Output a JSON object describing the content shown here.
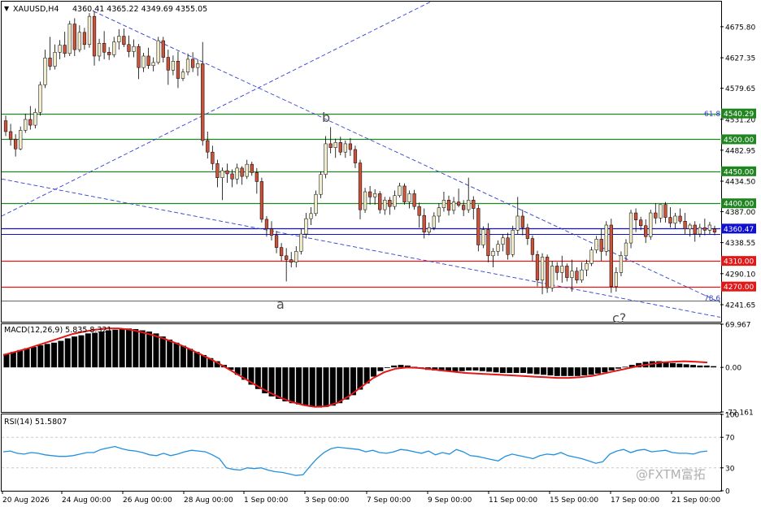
{
  "symbol": "XAUUSD,H4",
  "ohlc": "4360.41 4365.22 4349.69 4355.05",
  "macd_header": "MACD(12,26,9) 5.835 8.321",
  "rsi_header": "RSI(14) 51.5807",
  "watermark": "@FXTM富拓",
  "fib_labels": {
    "fib_618": "61.8",
    "fib_786": "78.6"
  },
  "wave_labels": {
    "a": "a",
    "b": "b",
    "c": "c?"
  },
  "colors": {
    "bull": "#f0eccc",
    "bear": "#c8533a",
    "support": "#208520",
    "resistance": "#e01818",
    "current": "#1010d0",
    "trendline": "#3040d0",
    "signal": "#e01818",
    "rsi": "#2090e0"
  },
  "price_axis": [
    "4675.80",
    "4627.35",
    "4579.65",
    "4531.20",
    "4482.95",
    "4434.50",
    "4387.00",
    "4338.55",
    "4290.10",
    "4241.65"
  ],
  "level_tags": [
    {
      "label": "4540.29",
      "color": "#208520"
    },
    {
      "label": "4500.00",
      "color": "#208520"
    },
    {
      "label": "4450.00",
      "color": "#208520"
    },
    {
      "label": "4400.00",
      "color": "#208520"
    },
    {
      "label": "4360.47",
      "color": "#1010d0"
    },
    {
      "label": "4310.00",
      "color": "#e01818"
    },
    {
      "label": "4270.00",
      "color": "#e01818"
    }
  ],
  "macd_axis": [
    "69.967",
    "0.00",
    "-72.161"
  ],
  "rsi_axis": [
    "100",
    "70",
    "30",
    "0"
  ],
  "time_axis": [
    "20 Aug 2026",
    "24 Aug 00:00",
    "26 Aug 00:00",
    "28 Aug 00:00",
    "1 Sep 00:00",
    "3 Sep 00:00",
    "7 Sep 00:00",
    "9 Sep 00:00",
    "11 Sep 00:00",
    "15 Sep 00:00",
    "17 Sep 00:00",
    "21 Sep 00:00"
  ],
  "chart_data": {
    "type": "candlestick",
    "ohlc": [
      [
        4529,
        4537,
        4505,
        4512
      ],
      [
        4512,
        4524,
        4490,
        4500
      ],
      [
        4500,
        4508,
        4473,
        4485
      ],
      [
        4485,
        4520,
        4483,
        4514
      ],
      [
        4514,
        4540,
        4510,
        4531
      ],
      [
        4531,
        4552,
        4515,
        4522
      ],
      [
        4522,
        4548,
        4517,
        4542
      ],
      [
        4542,
        4590,
        4537,
        4585
      ],
      [
        4585,
        4640,
        4580,
        4627
      ],
      [
        4627,
        4660,
        4608,
        4614
      ],
      [
        4614,
        4648,
        4609,
        4636
      ],
      [
        4636,
        4655,
        4625,
        4647
      ],
      [
        4647,
        4668,
        4628,
        4634
      ],
      [
        4634,
        4685,
        4630,
        4680
      ],
      [
        4680,
        4689,
        4630,
        4640
      ],
      [
        4640,
        4678,
        4636,
        4667
      ],
      [
        4667,
        4674,
        4640,
        4648
      ],
      [
        4648,
        4697,
        4643,
        4692
      ],
      [
        4692,
        4700,
        4615,
        4630
      ],
      [
        4630,
        4657,
        4622,
        4650
      ],
      [
        4650,
        4669,
        4625,
        4636
      ],
      [
        4636,
        4644,
        4624,
        4632
      ],
      [
        4632,
        4660,
        4628,
        4652
      ],
      [
        4652,
        4672,
        4640,
        4661
      ],
      [
        4661,
        4673,
        4644,
        4648
      ],
      [
        4648,
        4662,
        4628,
        4637
      ],
      [
        4637,
        4656,
        4628,
        4645
      ],
      [
        4645,
        4649,
        4594,
        4612
      ],
      [
        4612,
        4635,
        4605,
        4630
      ],
      [
        4630,
        4643,
        4610,
        4615
      ],
      [
        4615,
        4628,
        4606,
        4620
      ],
      [
        4620,
        4660,
        4617,
        4654
      ],
      [
        4654,
        4660,
        4620,
        4628
      ],
      [
        4628,
        4640,
        4585,
        4608
      ],
      [
        4608,
        4631,
        4600,
        4622
      ],
      [
        4622,
        4637,
        4580,
        4595
      ],
      [
        4595,
        4610,
        4591,
        4605
      ],
      [
        4605,
        4634,
        4600,
        4625
      ],
      [
        4625,
        4636,
        4605,
        4612
      ],
      [
        4612,
        4625,
        4599,
        4618
      ],
      [
        4618,
        4652,
        4490,
        4498
      ],
      [
        4498,
        4512,
        4470,
        4480
      ],
      [
        4480,
        4490,
        4452,
        4462
      ],
      [
        4462,
        4468,
        4425,
        4440
      ],
      [
        4440,
        4456,
        4405,
        4451
      ],
      [
        4451,
        4462,
        4432,
        4446
      ],
      [
        4446,
        4453,
        4425,
        4438
      ],
      [
        4438,
        4462,
        4430,
        4455
      ],
      [
        4455,
        4458,
        4429,
        4442
      ],
      [
        4442,
        4468,
        4438,
        4461
      ],
      [
        4461,
        4465,
        4443,
        4448
      ],
      [
        4448,
        4455,
        4415,
        4434
      ],
      [
        4434,
        4440,
        4370,
        4375
      ],
      [
        4375,
        4380,
        4348,
        4360
      ],
      [
        4360,
        4372,
        4342,
        4350
      ],
      [
        4350,
        4357,
        4322,
        4331
      ],
      [
        4331,
        4338,
        4310,
        4318
      ],
      [
        4318,
        4330,
        4278,
        4312
      ],
      [
        4312,
        4324,
        4300,
        4308
      ],
      [
        4308,
        4333,
        4300,
        4325
      ],
      [
        4325,
        4360,
        4320,
        4352
      ],
      [
        4352,
        4385,
        4345,
        4376
      ],
      [
        4376,
        4394,
        4366,
        4384
      ],
      [
        4384,
        4420,
        4380,
        4414
      ],
      [
        4414,
        4450,
        4408,
        4445
      ],
      [
        4445,
        4505,
        4439,
        4493
      ],
      [
        4493,
        4519,
        4478,
        4487
      ],
      [
        4487,
        4501,
        4471,
        4495
      ],
      [
        4495,
        4504,
        4475,
        4480
      ],
      [
        4480,
        4498,
        4471,
        4493
      ],
      [
        4493,
        4502,
        4474,
        4484
      ],
      [
        4484,
        4490,
        4455,
        4463
      ],
      [
        4463,
        4468,
        4375,
        4390
      ],
      [
        4390,
        4424,
        4385,
        4418
      ],
      [
        4418,
        4427,
        4398,
        4410
      ],
      [
        4410,
        4422,
        4398,
        4415
      ],
      [
        4415,
        4419,
        4384,
        4390
      ],
      [
        4390,
        4410,
        4382,
        4405
      ],
      [
        4405,
        4410,
        4382,
        4395
      ],
      [
        4395,
        4420,
        4390,
        4412
      ],
      [
        4412,
        4432,
        4409,
        4427
      ],
      [
        4427,
        4431,
        4398,
        4402
      ],
      [
        4402,
        4420,
        4392,
        4415
      ],
      [
        4415,
        4421,
        4390,
        4395
      ],
      [
        4395,
        4401,
        4362,
        4381
      ],
      [
        4381,
        4392,
        4345,
        4355
      ],
      [
        4355,
        4370,
        4350,
        4362
      ],
      [
        4362,
        4386,
        4358,
        4380
      ],
      [
        4380,
        4400,
        4370,
        4393
      ],
      [
        4393,
        4418,
        4387,
        4405
      ],
      [
        4405,
        4412,
        4381,
        4389
      ],
      [
        4389,
        4410,
        4383,
        4402
      ],
      [
        4402,
        4423,
        4394,
        4397
      ],
      [
        4397,
        4405,
        4380,
        4390
      ],
      [
        4390,
        4440,
        4385,
        4405
      ],
      [
        4405,
        4411,
        4375,
        4392
      ],
      [
        4392,
        4398,
        4325,
        4335
      ],
      [
        4335,
        4364,
        4330,
        4359
      ],
      [
        4359,
        4369,
        4308,
        4318
      ],
      [
        4318,
        4330,
        4300,
        4325
      ],
      [
        4325,
        4342,
        4318,
        4336
      ],
      [
        4336,
        4352,
        4325,
        4346
      ],
      [
        4346,
        4354,
        4312,
        4320
      ],
      [
        4320,
        4365,
        4316,
        4358
      ],
      [
        4358,
        4410,
        4352,
        4380
      ],
      [
        4380,
        4390,
        4350,
        4362
      ],
      [
        4362,
        4368,
        4335,
        4345
      ],
      [
        4345,
        4350,
        4310,
        4320
      ],
      [
        4320,
        4326,
        4270,
        4280
      ],
      [
        4280,
        4322,
        4258,
        4316
      ],
      [
        4316,
        4320,
        4260,
        4268
      ],
      [
        4268,
        4310,
        4262,
        4302
      ],
      [
        4302,
        4308,
        4280,
        4292
      ],
      [
        4292,
        4318,
        4276,
        4302
      ],
      [
        4302,
        4306,
        4278,
        4284
      ],
      [
        4284,
        4312,
        4262,
        4294
      ],
      [
        4294,
        4300,
        4275,
        4280
      ],
      [
        4280,
        4308,
        4276,
        4296
      ],
      [
        4296,
        4312,
        4286,
        4306
      ],
      [
        4306,
        4332,
        4302,
        4327
      ],
      [
        4327,
        4349,
        4322,
        4344
      ],
      [
        4344,
        4360,
        4310,
        4325
      ],
      [
        4325,
        4372,
        4318,
        4366
      ],
      [
        4366,
        4376,
        4260,
        4270
      ],
      [
        4270,
        4300,
        4262,
        4292
      ],
      [
        4292,
        4325,
        4286,
        4318
      ],
      [
        4318,
        4344,
        4310,
        4338
      ],
      [
        4338,
        4390,
        4330,
        4385
      ],
      [
        4385,
        4392,
        4355,
        4374
      ],
      [
        4374,
        4379,
        4358,
        4365
      ],
      [
        4365,
        4375,
        4338,
        4348
      ],
      [
        4348,
        4390,
        4343,
        4385
      ],
      [
        4385,
        4400,
        4368,
        4377
      ],
      [
        4377,
        4398,
        4370,
        4398
      ],
      [
        4398,
        4402,
        4370,
        4378
      ],
      [
        4378,
        4394,
        4362,
        4369
      ],
      [
        4369,
        4385,
        4360,
        4380
      ],
      [
        4380,
        4392,
        4368,
        4372
      ],
      [
        4372,
        4385,
        4352,
        4360
      ],
      [
        4360,
        4369,
        4348,
        4366
      ],
      [
        4366,
        4372,
        4340,
        4352
      ],
      [
        4352,
        4368,
        4347,
        4362
      ],
      [
        4362,
        4376,
        4350,
        4358
      ],
      [
        4358,
        4371,
        4352,
        4366
      ],
      [
        4360,
        4365,
        4350,
        4355
      ]
    ],
    "histogram": [
      22,
      25,
      28,
      31,
      33,
      36,
      38,
      40,
      43,
      47,
      50,
      52,
      55,
      56,
      58,
      60,
      61,
      62,
      63,
      62,
      60,
      58,
      55,
      50,
      45,
      40,
      35,
      30,
      25,
      20,
      15,
      10,
      4,
      -4,
      -12,
      -20,
      -28,
      -35,
      -42,
      -47,
      -51,
      -55,
      -58,
      -60,
      -62,
      -64,
      -65,
      -64,
      -62,
      -58,
      -52,
      -45,
      -36,
      -26,
      -15,
      -6,
      0,
      3,
      4,
      3,
      1,
      -2,
      -4,
      -5,
      -6,
      -7,
      -7,
      -6,
      -5,
      -5,
      -6,
      -7,
      -8,
      -9,
      -9,
      -9,
      -9,
      -10,
      -11,
      -12,
      -13,
      -14,
      -14,
      -14,
      -14,
      -13,
      -12,
      -10,
      -8,
      -5,
      -2,
      1,
      4,
      7,
      9,
      10,
      10,
      9,
      7,
      6,
      5,
      4,
      3,
      3,
      2
    ],
    "signal": [
      20,
      25,
      30,
      36,
      42,
      48,
      54,
      58,
      61,
      63,
      63,
      61,
      57,
      52,
      46,
      39,
      31,
      22,
      13,
      3,
      -8,
      -19,
      -30,
      -40,
      -49,
      -56,
      -61,
      -64,
      -63,
      -57,
      -46,
      -32,
      -18,
      -8,
      -2,
      0,
      -1,
      -3,
      -5,
      -7,
      -9,
      -10,
      -11,
      -12,
      -13,
      -14,
      -15,
      -16,
      -17,
      -17,
      -16,
      -14,
      -10,
      -6,
      -2,
      2,
      5,
      8,
      9,
      10,
      9,
      8
    ],
    "rsi": [
      51,
      52,
      49,
      48,
      50,
      49,
      47,
      46,
      45,
      45,
      46,
      48,
      50,
      50,
      54,
      56,
      58,
      55,
      53,
      52,
      50,
      47,
      46,
      49,
      46,
      48,
      51,
      53,
      52,
      51,
      47,
      42,
      30,
      28,
      27,
      30,
      29,
      30,
      27,
      25,
      24,
      22,
      20,
      21,
      32,
      42,
      50,
      55,
      57,
      56,
      55,
      54,
      51,
      53,
      50,
      49,
      51,
      54,
      53,
      51,
      49,
      52,
      47,
      50,
      48,
      54,
      51,
      46,
      45,
      43,
      41,
      39,
      45,
      48,
      46,
      44,
      42,
      46,
      48,
      47,
      50,
      46,
      44,
      42,
      39,
      36,
      38,
      48,
      52,
      54,
      50,
      53,
      54,
      51,
      52,
      53,
      50,
      49,
      49,
      48,
      51,
      52
    ],
    "levels": {
      "fib_618": 4540.29,
      "r1": 4500.0,
      "r2": 4450.0,
      "r3": 4400.0,
      "current": 4360.47,
      "s1": 4310.0,
      "s2": 4270.0,
      "fib_786": 4248.0
    },
    "price_range": [
      4215,
      4715
    ],
    "macd_range": [
      -72.161,
      69.967
    ],
    "rsi_range": [
      0,
      100
    ],
    "ytick_values": [
      4675.8,
      4627.35,
      4579.65,
      4531.2,
      4482.95,
      4434.5,
      4387.0,
      4338.55,
      4290.1,
      4241.65
    ],
    "waves": [
      {
        "label": "a",
        "index": 65,
        "price": 4243
      },
      {
        "label": "b",
        "index": 79,
        "price": 4530
      },
      {
        "label": "c?",
        "index": 142,
        "price": 4235
      }
    ]
  }
}
